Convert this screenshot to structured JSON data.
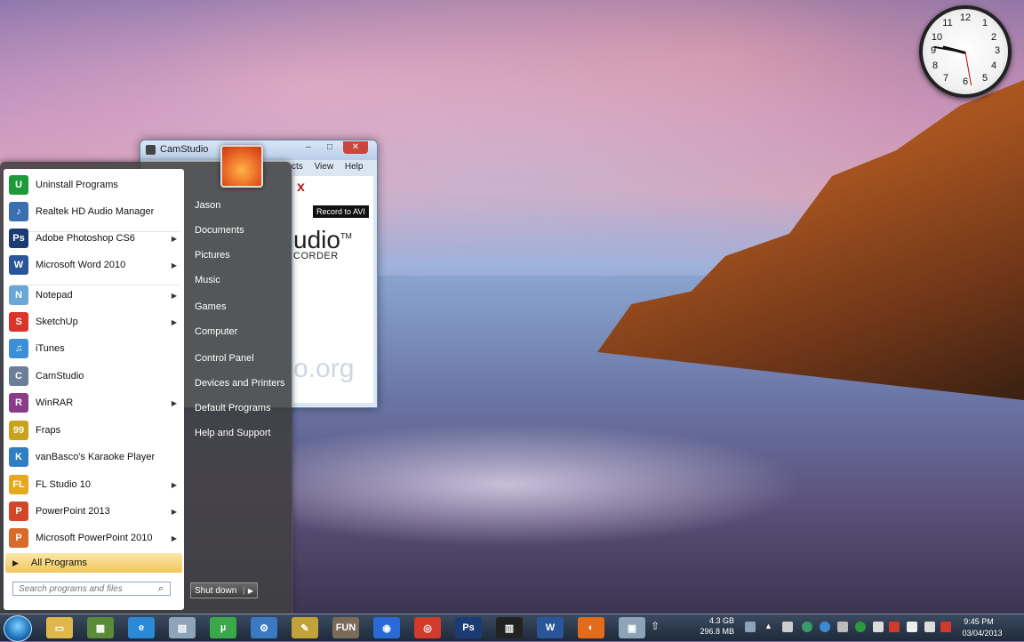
{
  "window": {
    "title": "CamStudio",
    "menu": [
      "cts",
      "View",
      "Help"
    ],
    "record_button": "Record to AVI",
    "logo_text": "udio",
    "logo_tm": "TM",
    "logo_sub": "CORDER",
    "logo_url": "o.org",
    "toolbar_icon": "x"
  },
  "start_menu": {
    "programs": [
      {
        "label": "Uninstall Programs",
        "icon": "uninstall-icon",
        "color": "#1f9a3a",
        "glyph": "U",
        "submenu": false
      },
      {
        "label": "Realtek HD Audio Manager",
        "icon": "audio-manager-icon",
        "color": "#3a6fb0",
        "glyph": "♪",
        "submenu": false
      },
      {
        "label": "Adobe Photoshop CS6",
        "icon": "photoshop-icon",
        "color": "#1b3c73",
        "glyph": "Ps",
        "submenu": true
      },
      {
        "label": "Microsoft Word 2010",
        "icon": "word-icon",
        "color": "#2a5699",
        "glyph": "W",
        "submenu": true
      },
      {
        "label": "Notepad",
        "icon": "notepad-icon",
        "color": "#6aa6d6",
        "glyph": "N",
        "submenu": true
      },
      {
        "label": "SketchUp",
        "icon": "sketchup-icon",
        "color": "#d9352b",
        "glyph": "S",
        "submenu": true
      },
      {
        "label": "iTunes",
        "icon": "itunes-icon",
        "color": "#3b8fd6",
        "glyph": "♫",
        "submenu": false
      },
      {
        "label": "CamStudio",
        "icon": "camstudio-icon",
        "color": "#6b7f99",
        "glyph": "C",
        "submenu": false
      },
      {
        "label": "WinRAR",
        "icon": "winrar-icon",
        "color": "#8a3b8a",
        "glyph": "R",
        "submenu": true
      },
      {
        "label": "Fraps",
        "icon": "fraps-icon",
        "color": "#c9a21c",
        "glyph": "99",
        "submenu": false
      },
      {
        "label": "vanBasco's Karaoke Player",
        "icon": "karaoke-icon",
        "color": "#2f7fc2",
        "glyph": "K",
        "submenu": false
      },
      {
        "label": "FL Studio 10",
        "icon": "fl-studio-icon",
        "color": "#e8a81e",
        "glyph": "FL",
        "submenu": true
      },
      {
        "label": "PowerPoint 2013",
        "icon": "powerpoint-2013-icon",
        "color": "#d24726",
        "glyph": "P",
        "submenu": true
      },
      {
        "label": "Microsoft PowerPoint 2010",
        "icon": "powerpoint-2010-icon",
        "color": "#d86a2a",
        "glyph": "P",
        "submenu": true
      }
    ],
    "all_programs": "All Programs",
    "search_placeholder": "Search programs and files",
    "right_items": [
      "Jason",
      "Documents",
      "Pictures",
      "Music",
      "Games",
      "Computer",
      "Control Panel",
      "Devices and Printers",
      "Default Programs",
      "Help and Support"
    ],
    "shutdown": "Shut down"
  },
  "clock": {
    "numbers": [
      "12",
      "1",
      "2",
      "3",
      "4",
      "5",
      "6",
      "7",
      "8",
      "9",
      "10",
      "11"
    ]
  },
  "taskbar": {
    "apps": [
      {
        "name": "explorer-icon",
        "color": "#e0b84a",
        "glyph": "▭"
      },
      {
        "name": "minecraft-icon",
        "color": "#5a8a3a",
        "glyph": "▦"
      },
      {
        "name": "internet-explorer-icon",
        "color": "#2a8ad6",
        "glyph": "e"
      },
      {
        "name": "calculator-icon",
        "color": "#8fa3b8",
        "glyph": "▤"
      },
      {
        "name": "utorrent-icon",
        "color": "#3aa84a",
        "glyph": "µ"
      },
      {
        "name": "network-icon",
        "color": "#3a7ac2",
        "glyph": "⚙"
      },
      {
        "name": "paint-icon",
        "color": "#c2a23a",
        "glyph": "✎"
      },
      {
        "name": "fun-icon",
        "color": "#7a6a5a",
        "glyph": "FUN"
      },
      {
        "name": "globe-icon",
        "color": "#2a6ad6",
        "glyph": "◉"
      },
      {
        "name": "chrome-icon",
        "color": "#d23a2a",
        "glyph": "◎"
      },
      {
        "name": "photoshop-taskbar-icon",
        "color": "#1b3c73",
        "glyph": "Ps"
      },
      {
        "name": "piano-icon",
        "color": "#222222",
        "glyph": "▥"
      },
      {
        "name": "word-taskbar-icon",
        "color": "#2a5699",
        "glyph": "W"
      },
      {
        "name": "firefox-icon",
        "color": "#e26b1c",
        "glyph": "◐"
      },
      {
        "name": "camstudio-taskbar-icon",
        "color": "#8fa3b8",
        "glyph": "▣"
      }
    ],
    "memory_top": "4.3 GB",
    "memory_bottom": "296.8 MB",
    "time": "9:45 PM",
    "date": "03/04/2013"
  }
}
